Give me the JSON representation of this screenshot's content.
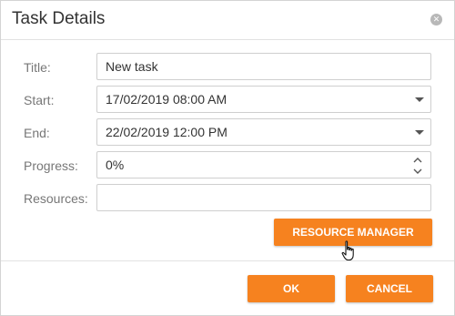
{
  "dialog": {
    "title": "Task Details",
    "close_icon": "close-icon"
  },
  "form": {
    "title_label": "Title:",
    "title_value": "New task",
    "start_label": "Start:",
    "start_value": "17/02/2019 08:00 AM",
    "end_label": "End:",
    "end_value": "22/02/2019 12:00 PM",
    "progress_label": "Progress:",
    "progress_value": "0%",
    "resources_label": "Resources:",
    "resources_value": ""
  },
  "buttons": {
    "resource_manager": "RESOURCE MANAGER",
    "ok": "OK",
    "cancel": "CANCEL"
  },
  "colors": {
    "accent": "#f6821f"
  }
}
